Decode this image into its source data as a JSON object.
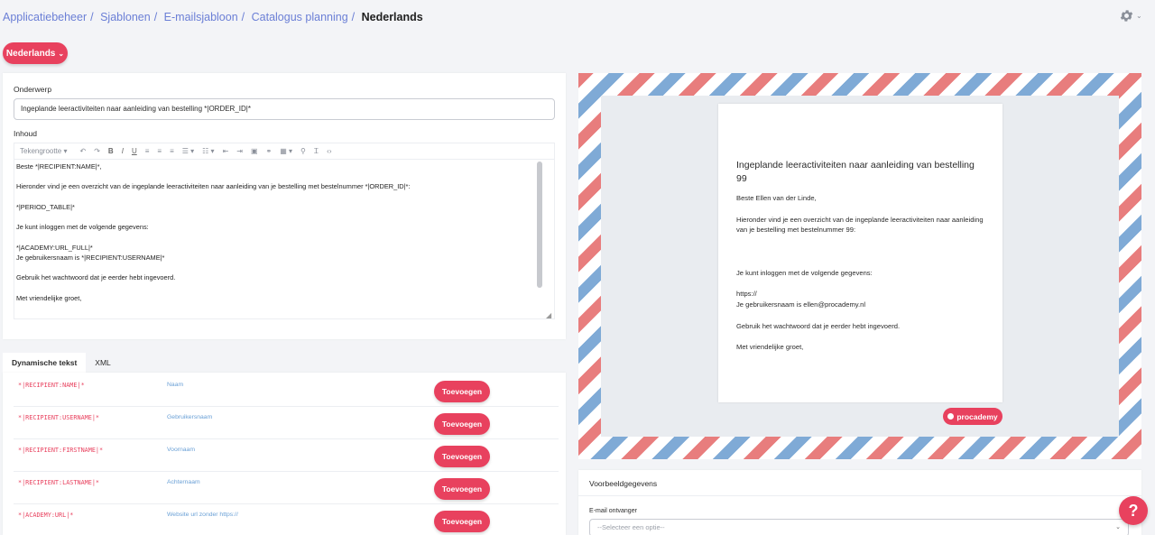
{
  "breadcrumb": {
    "items": [
      "Applicatiebeheer",
      "Sjablonen",
      "E-mailsjabloon",
      "Catalogus planning"
    ],
    "current": "Nederlands"
  },
  "icons": {
    "settings": "gear-icon",
    "help": "question-icon"
  },
  "language_button": {
    "label": "Nederlands",
    "caret": "⌄"
  },
  "colors": {
    "accent": "#e8415e",
    "link": "#6b7fd6",
    "code": "#e8415e",
    "desc": "#6aa0d6"
  },
  "editor": {
    "subject_label": "Onderwerp",
    "subject_value": "Ingeplande leeractiviteiten naar aanleiding van bestelling *|ORDER_ID|*",
    "content_label": "Inhoud",
    "font_size_label": "Tekengrootte",
    "body_lines": [
      "Beste *|RECIPIENT:NAME|*,",
      "",
      "Hieronder vind je een overzicht van de ingeplande leeractiviteiten naar aanleiding van je bestelling met bestelnummer *|ORDER_ID|*:",
      "",
      "*|PERIOD_TABLE|*",
      "",
      "Je kunt inloggen met de volgende gegevens:",
      "",
      "*|ACADEMY:URL_FULL|*",
      "Je gebruikersnaam is *|RECIPIENT:USERNAME|*",
      "",
      "Gebruik het wachtwoord dat je eerder hebt ingevoerd.",
      "",
      "Met vriendelijke groet,"
    ]
  },
  "tabs": [
    {
      "label": "Dynamische tekst",
      "active": true
    },
    {
      "label": "XML",
      "active": false
    }
  ],
  "dynamic_rows": [
    {
      "code": "*|RECIPIENT:NAME|*",
      "desc": "Naam",
      "button": "Toevoegen"
    },
    {
      "code": "*|RECIPIENT:USERNAME|*",
      "desc": "Gebruikersnaam",
      "button": "Toevoegen"
    },
    {
      "code": "*|RECIPIENT:FIRSTNAME|*",
      "desc": "Voornaam",
      "button": "Toevoegen"
    },
    {
      "code": "*|RECIPIENT:LASTNAME|*",
      "desc": "Achternaam",
      "button": "Toevoegen"
    },
    {
      "code": "*|ACADEMY:URL|*",
      "desc": "Website url zonder https://",
      "button": "Toevoegen"
    }
  ],
  "preview": {
    "title": "Ingeplande leeractiviteiten naar aanleiding van bestelling 99",
    "greeting": "Beste Ellen van der Linde,",
    "intro": "Hieronder vind je een overzicht van de ingeplande leeractiviteiten naar aanleiding van je bestelling met bestelnummer 99:",
    "login": "Je kunt inloggen met de volgende gegevens:",
    "url": "https://",
    "username": "Je gebruikersnaam is ellen@procademy.nl",
    "password": "Gebruik het wachtwoord dat je eerder hebt ingevoerd.",
    "closing": "Met vriendelijke groet,",
    "logo": "procademy"
  },
  "sample": {
    "title": "Voorbeeldgegevens",
    "field_label": "E-mail ontvanger",
    "placeholder": "--Selecteer een optie--"
  },
  "help_button": "?"
}
